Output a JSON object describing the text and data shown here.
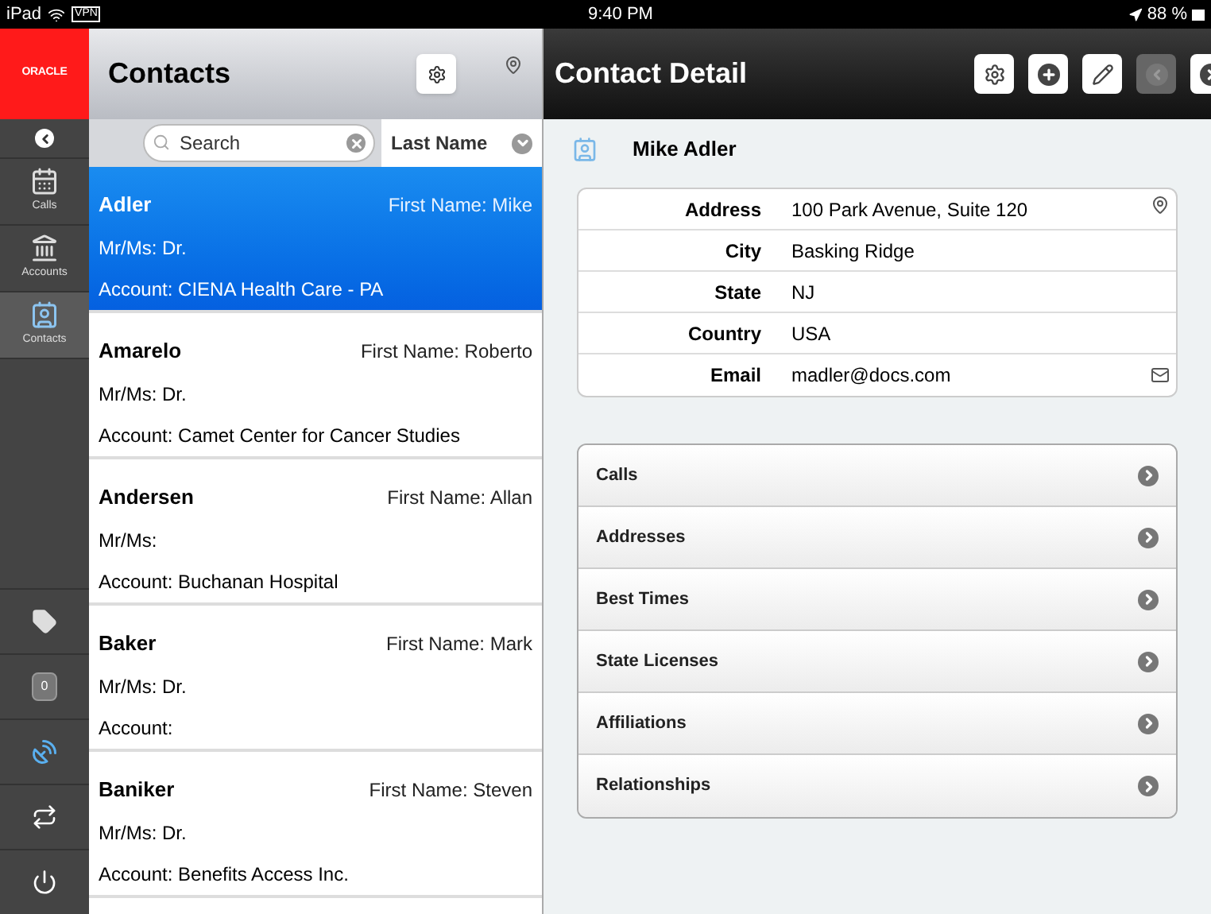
{
  "status_bar": {
    "carrier": "iPad",
    "vpn": "VPN",
    "time": "9:40 PM",
    "battery": "88 %"
  },
  "rail": {
    "logo": "ORACLE",
    "nav_items": [
      {
        "kind": "calls",
        "label": "Calls",
        "selected": false
      },
      {
        "kind": "accounts",
        "label": "Accounts",
        "selected": false
      },
      {
        "kind": "contacts",
        "label": "Contacts",
        "selected": true
      }
    ],
    "tools": [
      {
        "kind": "tag"
      },
      {
        "kind": "counter",
        "text": "0"
      },
      {
        "kind": "satellite"
      },
      {
        "kind": "sync"
      },
      {
        "kind": "power"
      }
    ]
  },
  "contacts": {
    "title": "Contacts",
    "search": {
      "placeholder": "Search"
    },
    "sort": "Last Name",
    "rows": [
      {
        "last_name": "Adler",
        "first_name": "First Name: Mike",
        "title": "Mr/Ms: Dr.",
        "account": "Account: CIENA Health Care - PA",
        "selected": true
      },
      {
        "last_name": "Amarelo",
        "first_name": "First Name: Roberto",
        "title": "Mr/Ms: Dr.",
        "account": "Account: Camet Center for Cancer Studies",
        "selected": false
      },
      {
        "last_name": "Andersen",
        "first_name": "First Name: Allan",
        "title": "Mr/Ms:",
        "account": "Account: Buchanan Hospital",
        "selected": false
      },
      {
        "last_name": "Baker",
        "first_name": "First Name: Mark",
        "title": "Mr/Ms: Dr.",
        "account": "Account:",
        "selected": false
      },
      {
        "last_name": "Baniker",
        "first_name": "First Name: Steven",
        "title": "Mr/Ms: Dr.",
        "account": "Account: Benefits Access Inc.",
        "selected": false
      }
    ]
  },
  "detail": {
    "title": "Contact Detail",
    "toolbar": [
      {
        "kind": "settings",
        "disabled": false
      },
      {
        "kind": "add",
        "disabled": false
      },
      {
        "kind": "edit",
        "disabled": false
      },
      {
        "kind": "previous",
        "disabled": true
      },
      {
        "kind": "next",
        "disabled": false
      }
    ],
    "name": "Mike Adler",
    "fields": [
      {
        "label": "Address",
        "value": "100 Park Avenue, Suite 120",
        "kind": "address"
      },
      {
        "label": "City",
        "value": "Basking Ridge",
        "kind": "plain"
      },
      {
        "label": "State",
        "value": "NJ",
        "kind": "plain"
      },
      {
        "label": "Country",
        "value": "USA",
        "kind": "plain"
      },
      {
        "label": "Email",
        "value": "madler@docs.com",
        "kind": "email"
      }
    ],
    "sections": [
      "Calls",
      "Addresses",
      "Best Times",
      "State Licenses",
      "Affiliations",
      "Relationships"
    ]
  }
}
